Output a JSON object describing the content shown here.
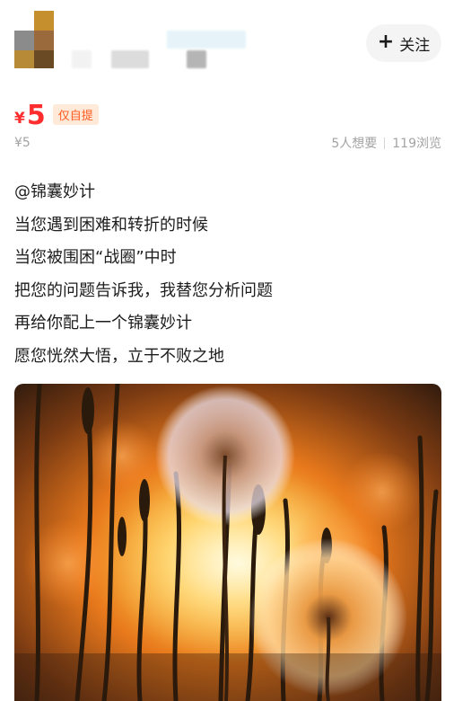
{
  "follow_button": {
    "label": "关注",
    "icon": "plus-icon"
  },
  "price": {
    "symbol": "¥",
    "value": "5",
    "tag": "仅自提"
  },
  "original_price": "¥5",
  "stats": {
    "wants": "5人想要",
    "views": "119浏览"
  },
  "description": [
    "@锦囊妙计",
    "当您遇到困难和转折的时候",
    "当您被围困“战圈”中时",
    "把您的问题告诉我，我替您分析问题",
    "再给你配上一个锦囊妙计",
    "愿您恍然大悟，立于不败之地"
  ],
  "photo": {
    "subject": "dandelion-sunset-image"
  },
  "colors": {
    "price": "#ff2d2d",
    "tag_bg": "#ffe9d8",
    "tag_text": "#ff5a1f",
    "muted": "#a3a3a3"
  }
}
